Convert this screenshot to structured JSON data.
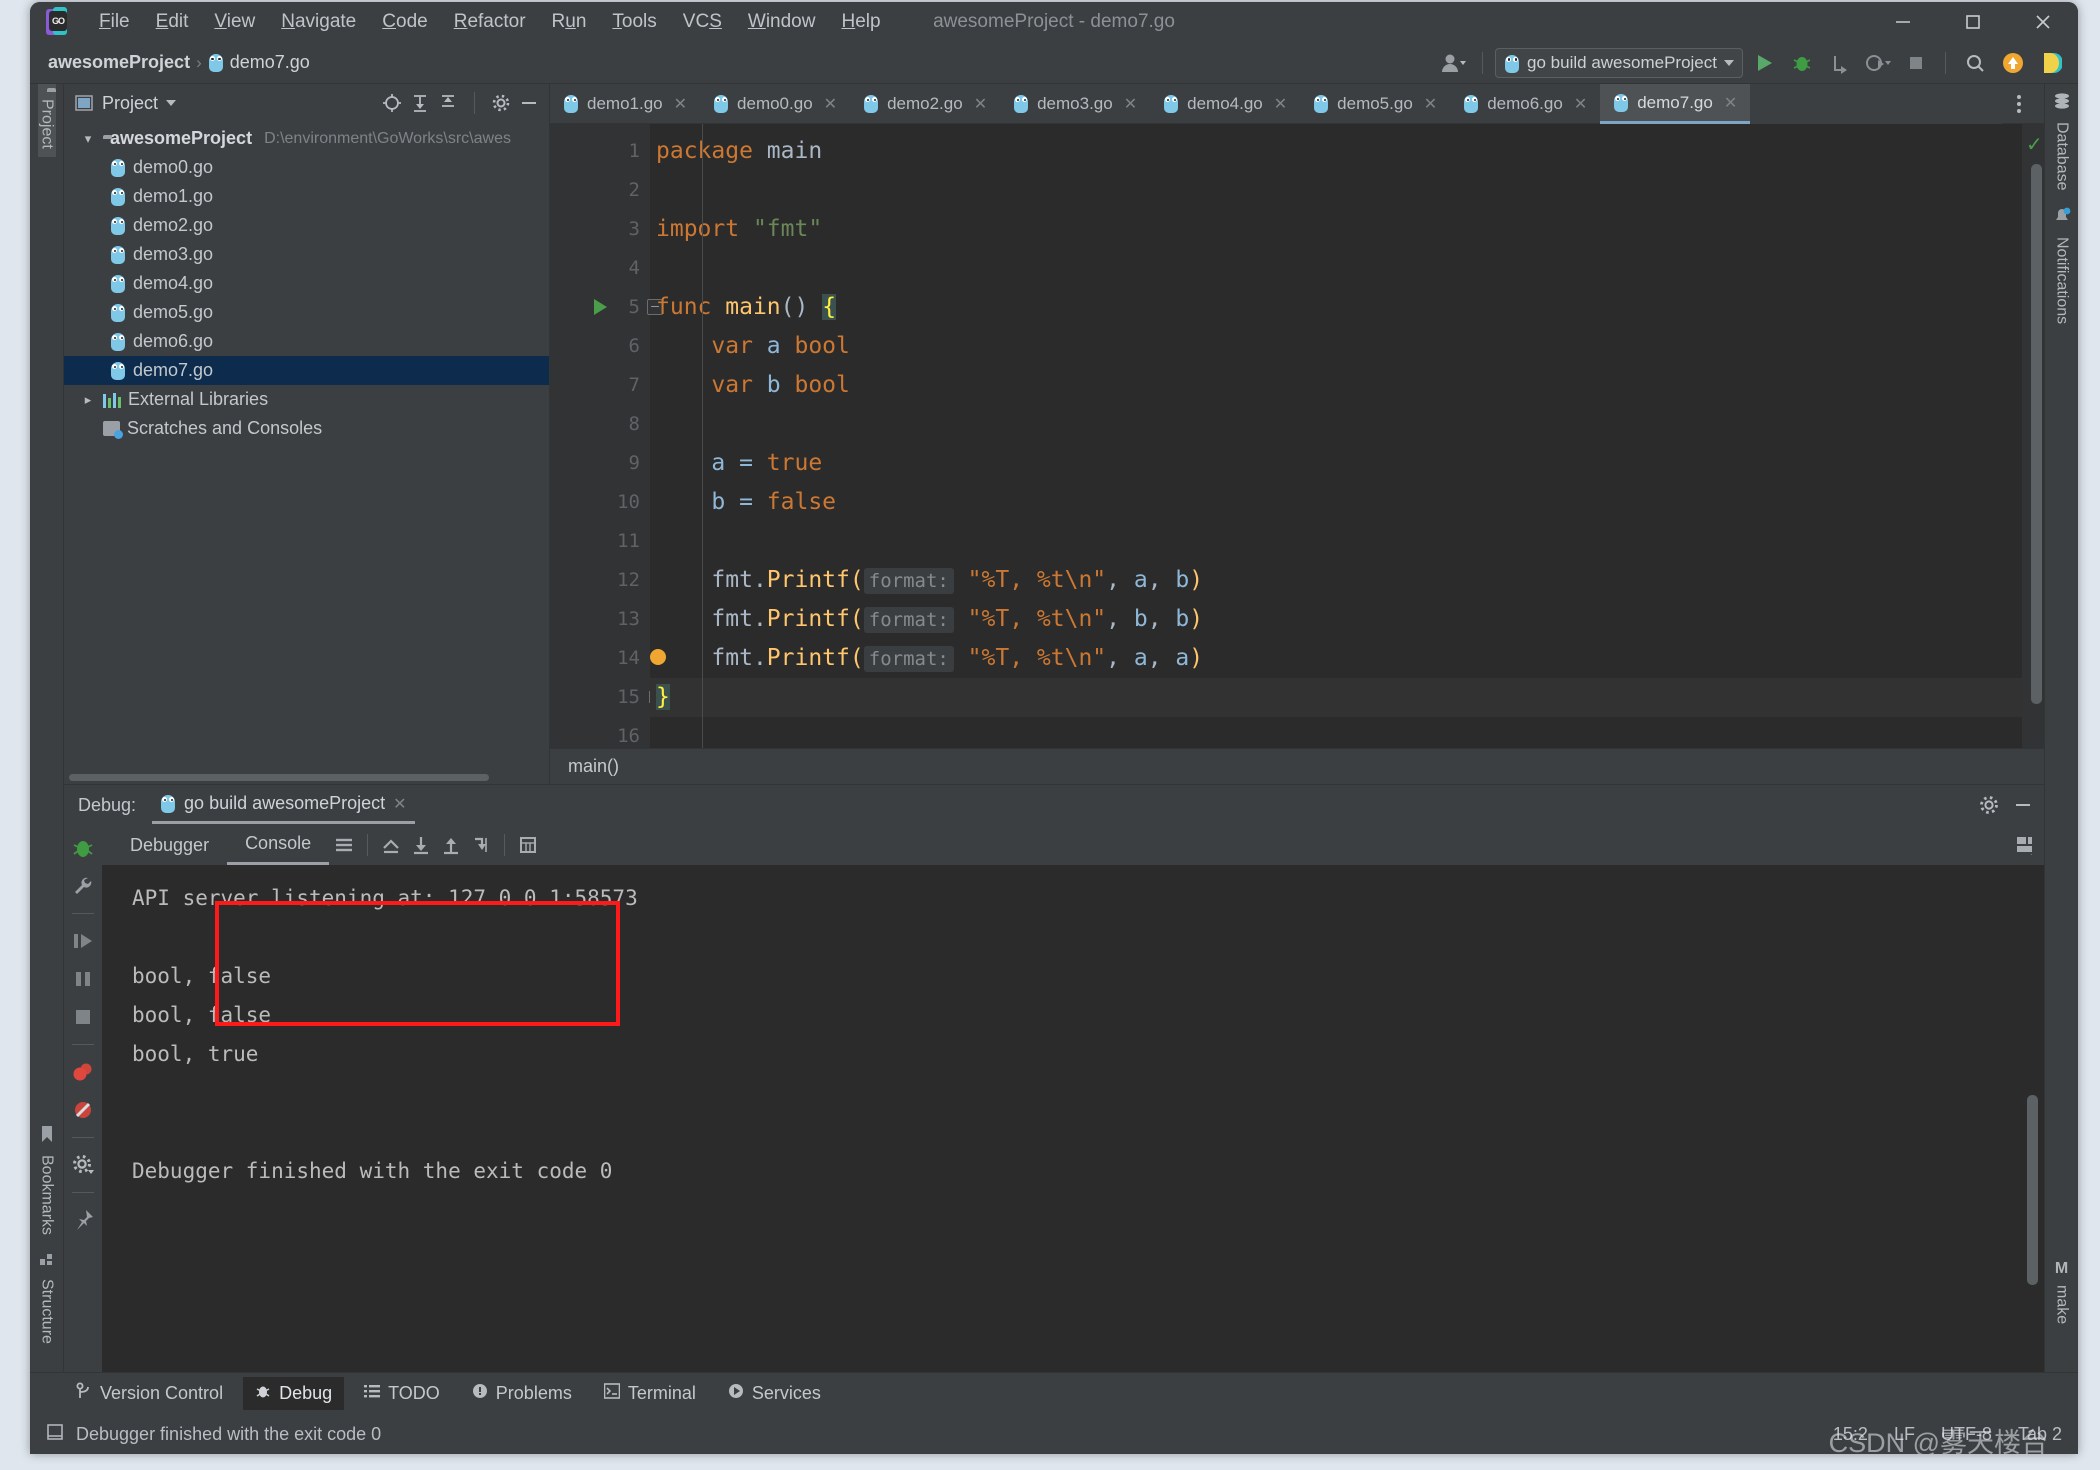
{
  "window": {
    "title": "awesomeProject - demo7.go",
    "minimize": "–",
    "maximize": "□",
    "close": "✕"
  },
  "menu": [
    "File",
    "Edit",
    "View",
    "Navigate",
    "Code",
    "Refactor",
    "Run",
    "Tools",
    "VCS",
    "Window",
    "Help"
  ],
  "breadcrumb": {
    "project": "awesomeProject",
    "sep": "›",
    "file": "demo7.go"
  },
  "toolbar": {
    "run_config": "go build awesomeProject",
    "icons": [
      "account-icon",
      "run-icon",
      "debug-icon",
      "run-with-coverage-icon",
      "profile-icon",
      "stop-icon",
      "search-icon",
      "update-icon",
      "ide-icon"
    ]
  },
  "left_rail": {
    "project": "Project",
    "bookmarks": "Bookmarks",
    "structure": "Structure"
  },
  "right_rail": {
    "database": "Database",
    "notifications": "Notifications",
    "make": "make",
    "make_badge": "M"
  },
  "project_panel": {
    "title": "Project",
    "header_icons": [
      "locate-icon",
      "expand-all-icon",
      "collapse-all-icon",
      "gear-icon",
      "hide-icon"
    ],
    "tree": [
      {
        "label": "awesomeProject",
        "path": "D:\\environment\\GoWorks\\src\\awes",
        "type": "root",
        "expanded": true,
        "selected": false
      },
      {
        "label": "demo0.go",
        "type": "go",
        "selected": false
      },
      {
        "label": "demo1.go",
        "type": "go",
        "selected": false
      },
      {
        "label": "demo2.go",
        "type": "go",
        "selected": false
      },
      {
        "label": "demo3.go",
        "type": "go",
        "selected": false
      },
      {
        "label": "demo4.go",
        "type": "go",
        "selected": false
      },
      {
        "label": "demo5.go",
        "type": "go",
        "selected": false
      },
      {
        "label": "demo6.go",
        "type": "go",
        "selected": false
      },
      {
        "label": "demo7.go",
        "type": "go",
        "selected": true
      },
      {
        "label": "External Libraries",
        "type": "libs",
        "expanded": false,
        "selected": false
      },
      {
        "label": "Scratches and Consoles",
        "type": "scratch",
        "selected": false
      }
    ]
  },
  "editor": {
    "tabs": [
      {
        "label": "demo1.go",
        "active": false
      },
      {
        "label": "demo0.go",
        "active": false
      },
      {
        "label": "demo2.go",
        "active": false
      },
      {
        "label": "demo3.go",
        "active": false
      },
      {
        "label": "demo4.go",
        "active": false
      },
      {
        "label": "demo5.go",
        "active": false
      },
      {
        "label": "demo6.go",
        "active": false
      },
      {
        "label": "demo7.go",
        "active": true
      }
    ],
    "close_glyph": "✕",
    "breadcrumb": "main()",
    "line_numbers": [
      "1",
      "2",
      "3",
      "4",
      "5",
      "6",
      "7",
      "8",
      "9",
      "10",
      "11",
      "12",
      "13",
      "14",
      "15",
      "16"
    ],
    "lines": [
      {
        "n": 1,
        "tokens": [
          {
            "t": "package ",
            "c": "kw"
          },
          {
            "t": "main",
            "c": "pk"
          }
        ]
      },
      {
        "n": 2,
        "tokens": []
      },
      {
        "n": 3,
        "tokens": [
          {
            "t": "import ",
            "c": "kw"
          },
          {
            "t": "\"fmt\"",
            "c": "str"
          }
        ]
      },
      {
        "n": 4,
        "tokens": []
      },
      {
        "n": 5,
        "tokens": [
          {
            "t": "func ",
            "c": "kw"
          },
          {
            "t": "main",
            "c": "fn"
          },
          {
            "t": "() ",
            "c": "pk"
          },
          {
            "t": "{",
            "c": "brace-hl"
          }
        ]
      },
      {
        "n": 6,
        "tokens": [
          {
            "t": "    var ",
            "c": "kw"
          },
          {
            "t": "a ",
            "c": "var"
          },
          {
            "t": "bool",
            "c": "kw"
          }
        ]
      },
      {
        "n": 7,
        "tokens": [
          {
            "t": "    var ",
            "c": "kw"
          },
          {
            "t": "b ",
            "c": "var"
          },
          {
            "t": "bool",
            "c": "kw"
          }
        ]
      },
      {
        "n": 8,
        "tokens": []
      },
      {
        "n": 9,
        "tokens": [
          {
            "t": "    a = ",
            "c": "var"
          },
          {
            "t": "true",
            "c": "kw"
          }
        ]
      },
      {
        "n": 10,
        "tokens": [
          {
            "t": "    b = ",
            "c": "var"
          },
          {
            "t": "false",
            "c": "kw"
          }
        ]
      },
      {
        "n": 11,
        "tokens": []
      },
      {
        "n": 12,
        "tokens": [
          {
            "t": "    fmt",
            "c": "pk"
          },
          {
            "t": ".",
            "c": "pk"
          },
          {
            "t": "Printf",
            "c": "fn"
          },
          {
            "t": "(",
            "c": "fn"
          },
          {
            "t": "format:",
            "c": "hint"
          },
          {
            "t": " \"%T, %t\\n\"",
            "c": "fmt-str"
          },
          {
            "t": ", ",
            "c": "pk"
          },
          {
            "t": "a",
            "c": "var"
          },
          {
            "t": ", ",
            "c": "pk"
          },
          {
            "t": "b",
            "c": "var"
          },
          {
            "t": ")",
            "c": "fn"
          }
        ]
      },
      {
        "n": 13,
        "tokens": [
          {
            "t": "    fmt",
            "c": "pk"
          },
          {
            "t": ".",
            "c": "pk"
          },
          {
            "t": "Printf",
            "c": "fn"
          },
          {
            "t": "(",
            "c": "fn"
          },
          {
            "t": "format:",
            "c": "hint"
          },
          {
            "t": " \"%T, %t\\n\"",
            "c": "fmt-str"
          },
          {
            "t": ", ",
            "c": "pk"
          },
          {
            "t": "b",
            "c": "var"
          },
          {
            "t": ", ",
            "c": "pk"
          },
          {
            "t": "b",
            "c": "var"
          },
          {
            "t": ")",
            "c": "fn"
          }
        ]
      },
      {
        "n": 14,
        "tokens": [
          {
            "t": "    fmt",
            "c": "pk"
          },
          {
            "t": ".",
            "c": "pk"
          },
          {
            "t": "Printf",
            "c": "fn"
          },
          {
            "t": "(",
            "c": "fn"
          },
          {
            "t": "format:",
            "c": "hint"
          },
          {
            "t": " \"%T, %t\\n\"",
            "c": "fmt-str"
          },
          {
            "t": ", ",
            "c": "pk"
          },
          {
            "t": "a",
            "c": "var"
          },
          {
            "t": ", ",
            "c": "pk"
          },
          {
            "t": "a",
            "c": "var"
          },
          {
            "t": ")",
            "c": "fn"
          }
        ]
      },
      {
        "n": 15,
        "tokens": [
          {
            "t": "}",
            "c": "brace-hl"
          }
        ],
        "current": true
      },
      {
        "n": 16,
        "tokens": []
      }
    ],
    "inspection_ok": "✓"
  },
  "debug": {
    "label": "Debug:",
    "session_tab": "go build awesomeProject",
    "close_glyph": "✕",
    "tabs": [
      {
        "label": "Debugger",
        "active": false
      },
      {
        "label": "Console",
        "active": true
      }
    ],
    "toolbar_icons": [
      "soft-wrap-icon",
      "scroll-to-top-icon",
      "scroll-to-end-icon",
      "up-stack-icon",
      "down-stack-icon",
      "print-icon"
    ],
    "rail_icons": [
      "bug-icon",
      "wrench-icon",
      "resume-icon",
      "pause-icon",
      "stop-icon",
      "breakpoints-icon",
      "mute-breakpoints-icon",
      "settings-icon",
      "pin-icon"
    ],
    "header_right_icons": [
      "gear-icon",
      "minimize-icon"
    ],
    "console_lines": [
      {
        "text": "API server listening at: 127.0.0.1:58573",
        "highlighted": false
      },
      {
        "text": "",
        "highlighted": false
      },
      {
        "text": "bool, false",
        "highlighted": true
      },
      {
        "text": "bool, false",
        "highlighted": true
      },
      {
        "text": "bool, true",
        "highlighted": true
      },
      {
        "text": "",
        "highlighted": false
      },
      {
        "text": "",
        "highlighted": false
      },
      {
        "text": "Debugger finished with the exit code 0",
        "highlighted": false
      }
    ],
    "annotation_color": "#ff1a1a"
  },
  "tool_window_bar": [
    {
      "label": "Version Control",
      "icon": "branch-icon",
      "active": false
    },
    {
      "label": "Debug",
      "icon": "bug-icon",
      "active": true
    },
    {
      "label": "TODO",
      "icon": "list-icon",
      "active": false
    },
    {
      "label": "Problems",
      "icon": "warning-icon",
      "active": false
    },
    {
      "label": "Terminal",
      "icon": "terminal-icon",
      "active": false
    },
    {
      "label": "Services",
      "icon": "services-icon",
      "active": false
    }
  ],
  "status_bar": {
    "message": "Debugger finished with the exit code 0",
    "caret": "15:2",
    "line_sep": "LF",
    "encoding": "UTF-8",
    "indent": "Tab 2",
    "watermark": "CSDN @雾天楼台"
  }
}
